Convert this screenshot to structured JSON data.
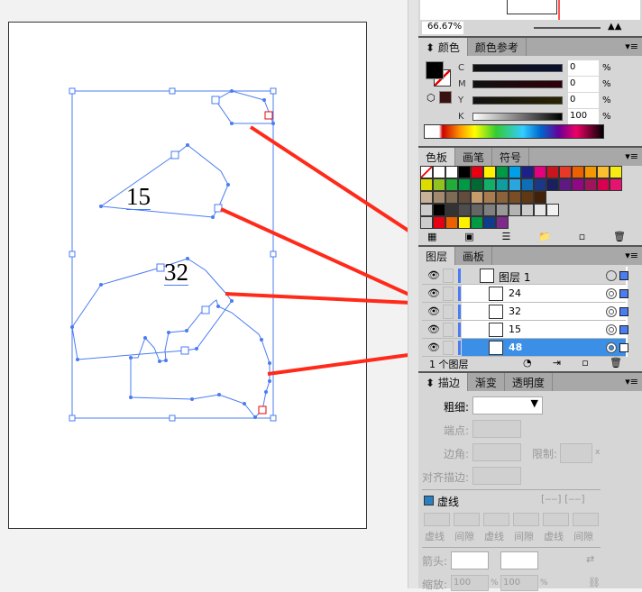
{
  "navigator": {
    "zoom": "66.67%"
  },
  "color_panel": {
    "tabs": [
      "颜色",
      "颜色参考"
    ],
    "sliders": [
      {
        "label": "C",
        "value": "0",
        "unit": "%"
      },
      {
        "label": "M",
        "value": "0",
        "unit": "%"
      },
      {
        "label": "Y",
        "value": "0",
        "unit": "%"
      },
      {
        "label": "K",
        "value": "100",
        "unit": "%"
      }
    ]
  },
  "swatches_panel": {
    "tabs": [
      "色板",
      "画笔",
      "符号"
    ],
    "colors": [
      "#000000",
      "#e60012",
      "#fff100",
      "#009944",
      "#00a0e9",
      "#1d2088",
      "#e4007f",
      "#c9151e",
      "#e83828",
      "#eb6100",
      "#f39800",
      "#fabe2e",
      "#f6eb12",
      "#dcdc00",
      "#8fc31f",
      "#22ac38",
      "#009944",
      "#006934",
      "#13ae67",
      "#0f9e9e",
      "#29a6df",
      "#0e6eb8",
      "#1d3788",
      "#1a1f5e",
      "#5f1985",
      "#920783",
      "#a0145a",
      "#d7004f",
      "#e5146f",
      "#c7b299",
      "#a38a6f",
      "#7d6b56",
      "#624d3d",
      "#c69c6d",
      "#a87c4f",
      "#8c6239",
      "#7b4d25",
      "#603813",
      "#42210b"
    ],
    "grays": [
      "#000000",
      "#333333",
      "#4d4d4d",
      "#666666",
      "#808080",
      "#999999",
      "#b3b3b3",
      "#cccccc",
      "#e6e6e6",
      "#f2f2f2"
    ],
    "group2": [
      "#e60012",
      "#eb6100",
      "#fff100",
      "#009944",
      "#0d3d8c",
      "#7d2a8c"
    ]
  },
  "layers_panel": {
    "tabs": [
      "图层",
      "画板"
    ],
    "layer": "图层 1",
    "items": [
      {
        "name": "24"
      },
      {
        "name": "32"
      },
      {
        "name": "15"
      },
      {
        "name": "48",
        "selected": true
      }
    ],
    "footer": "1 个图层"
  },
  "stroke_panel": {
    "tabs": [
      "描边",
      "渐变",
      "透明度"
    ],
    "weight_label": "粗细:",
    "cap_label": "端点:",
    "corner_label": "边角:",
    "limit_label": "限制:",
    "limit_unit": "x",
    "align_label": "对齐描边:",
    "dashed_label": "虚线",
    "dash_fields": [
      "虚线",
      "间隙",
      "虚线",
      "间隙",
      "虚线",
      "间隙"
    ],
    "arrow_label": "箭头:",
    "scale_label": "缩放:",
    "scale1": "100",
    "scale2": "100",
    "pct": "%"
  },
  "canvas": {
    "labels": [
      {
        "text": "15"
      },
      {
        "text": "32"
      }
    ]
  },
  "accent": "#4a7cf2",
  "arrow_color": "#ff2a1a"
}
